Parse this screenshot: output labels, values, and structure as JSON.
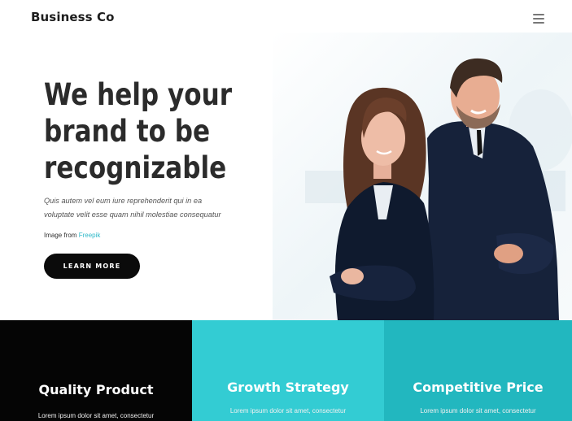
{
  "header": {
    "brand": "Business Co",
    "menu_icon": "hamburger-icon"
  },
  "hero": {
    "title_lines": [
      "We help your",
      "brand to be",
      "recognizable"
    ],
    "subtitle_lines": [
      "Quis autem vel eum iure reprehenderit qui in ea",
      "voluptate velit esse quam nihil molestiae consequatur"
    ],
    "credit_prefix": "Image from",
    "credit_link": "Freepik",
    "cta_label": "LEARN MORE"
  },
  "features": [
    {
      "title": "Quality Product",
      "text": "Lorem ipsum dolor sit amet, consectetur",
      "color": "#050505"
    },
    {
      "title": "Growth Strategy",
      "text": "Lorem ipsum dolor sit amet, consectetur",
      "color": "#33ccd3"
    },
    {
      "title": "Competitive Price",
      "text": "Lorem ipsum dolor sit amet, consectetur",
      "color": "#22b7bf"
    }
  ],
  "colors": {
    "accent": "#2fb9c8",
    "button_bg": "#0b0b0b"
  }
}
